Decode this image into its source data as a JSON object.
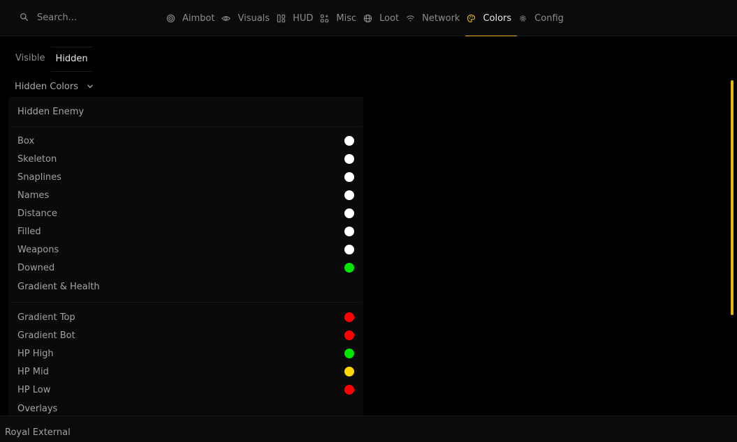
{
  "search": {
    "placeholder": "Search..."
  },
  "nav": {
    "tabs": [
      {
        "label": "Aimbot",
        "icon": "target-icon"
      },
      {
        "label": "Visuals",
        "icon": "eye-icon"
      },
      {
        "label": "HUD",
        "icon": "hud-icon"
      },
      {
        "label": "Misc",
        "icon": "apps-icon"
      },
      {
        "label": "Loot",
        "icon": "globe-icon"
      },
      {
        "label": "Network",
        "icon": "wifi-icon"
      },
      {
        "label": "Colors",
        "icon": "palette-icon"
      },
      {
        "label": "Config",
        "icon": "gear-icon"
      }
    ],
    "active": "Colors"
  },
  "subtabs": [
    {
      "label": "Visible",
      "active": false
    },
    {
      "label": "Hidden",
      "active": true
    }
  ],
  "group": {
    "label": "Hidden Colors",
    "icon": "chevron-down-icon"
  },
  "panel": {
    "section1": {
      "title": "Hidden Enemy",
      "rows": [
        {
          "label": "Box",
          "color": "#ffffff"
        },
        {
          "label": "Skeleton",
          "color": "#ffffff"
        },
        {
          "label": "Snaplines",
          "color": "#ffffff"
        },
        {
          "label": "Names",
          "color": "#ffffff"
        },
        {
          "label": "Distance",
          "color": "#ffffff"
        },
        {
          "label": "Filled",
          "color": "#ffffff"
        },
        {
          "label": "Weapons",
          "color": "#ffffff"
        },
        {
          "label": "Downed",
          "color": "#00e600"
        }
      ]
    },
    "section2": {
      "title": "Gradient & Health",
      "rows": [
        {
          "label": "Gradient Top",
          "color": "#ff0000"
        },
        {
          "label": "Gradient Bot",
          "color": "#ff0000"
        },
        {
          "label": "HP High",
          "color": "#00e600"
        },
        {
          "label": "HP Mid",
          "color": "#ffd700"
        },
        {
          "label": "HP Low",
          "color": "#ff0000"
        }
      ]
    },
    "section3": {
      "title": "Overlays"
    }
  },
  "colors": {
    "accent": "#e2b714",
    "background": "#000000",
    "panel": "#0a0a0a"
  },
  "footer": {
    "title": "Royal External"
  }
}
